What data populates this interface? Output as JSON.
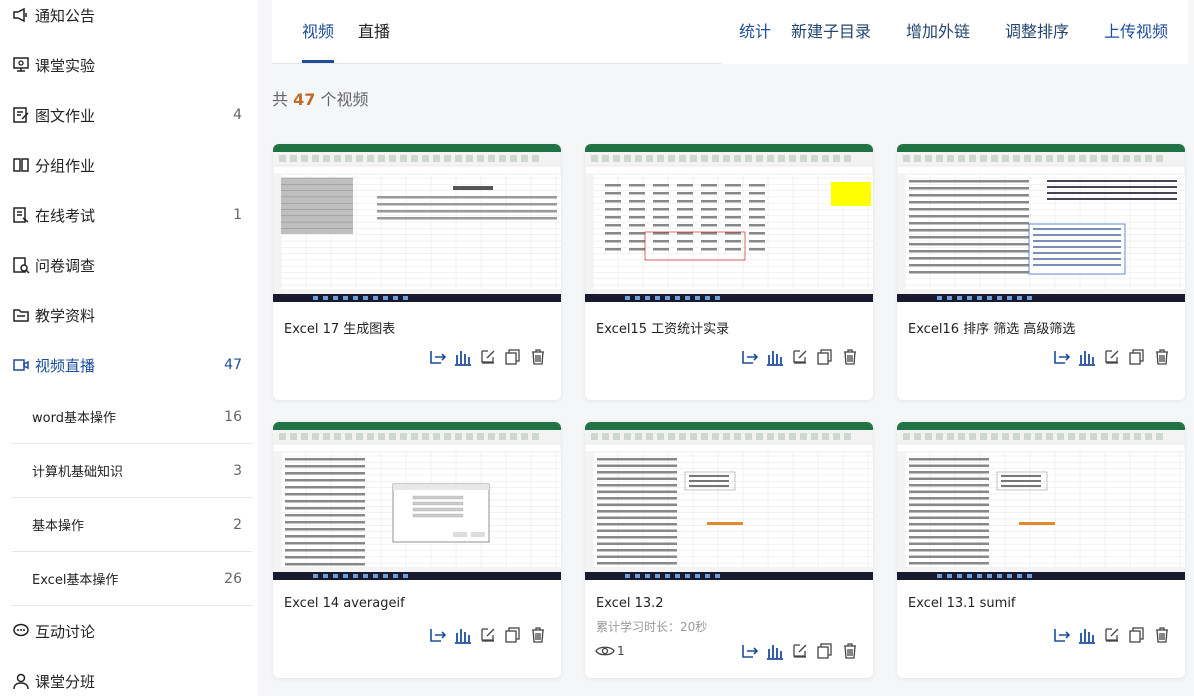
{
  "sidebar": {
    "items": [
      {
        "label": "通知公告",
        "icon": "megaphone-icon",
        "count": ""
      },
      {
        "label": "课堂实验",
        "icon": "experiment-icon",
        "count": ""
      },
      {
        "label": "图文作业",
        "icon": "edit-doc-icon",
        "count": "4"
      },
      {
        "label": "分组作业",
        "icon": "book-icon",
        "count": ""
      },
      {
        "label": "在线考试",
        "icon": "exam-icon",
        "count": "1"
      },
      {
        "label": "问卷调查",
        "icon": "survey-icon",
        "count": ""
      },
      {
        "label": "教学资料",
        "icon": "folder-icon",
        "count": ""
      },
      {
        "label": "视频直播",
        "icon": "video-icon",
        "count": "47",
        "active": true
      }
    ],
    "subitems": [
      {
        "label": "word基本操作",
        "count": "16"
      },
      {
        "label": "计算机基础知识",
        "count": "3"
      },
      {
        "label": "基本操作",
        "count": "2"
      },
      {
        "label": "Excel基本操作",
        "count": "26"
      }
    ],
    "bottom_items": [
      {
        "label": "互动讨论",
        "icon": "chat-icon"
      },
      {
        "label": "课堂分班",
        "icon": "user-icon"
      }
    ]
  },
  "tabs": [
    {
      "label": "视频",
      "active": true
    },
    {
      "label": "直播",
      "active": false
    }
  ],
  "actions": [
    "统计",
    "新建子目录",
    "增加外链",
    "调整排序",
    "上传视频"
  ],
  "summary": {
    "prefix": "共",
    "count": "47",
    "suffix": "个视频"
  },
  "cards": [
    {
      "title": "Excel 17 生成图表",
      "meta": "",
      "views": "",
      "thumb": "chart"
    },
    {
      "title": "Excel15 工资统计实录",
      "meta": "",
      "views": "",
      "thumb": "salary"
    },
    {
      "title": "Excel16 排序 筛选 高级筛选",
      "meta": "",
      "views": "",
      "thumb": "filter"
    },
    {
      "title": "Excel 14 averageif",
      "meta": "",
      "views": "",
      "thumb": "dialog"
    },
    {
      "title": "Excel 13.2",
      "meta": "累计学习时长：20秒",
      "views": "1",
      "thumb": "sheet"
    },
    {
      "title": "Excel 13.1 sumif",
      "meta": "",
      "views": "",
      "thumb": "sheet2"
    }
  ],
  "colors": {
    "accent": "#1e4d9e",
    "count": "#c26a28",
    "excel_green": "#217346"
  }
}
